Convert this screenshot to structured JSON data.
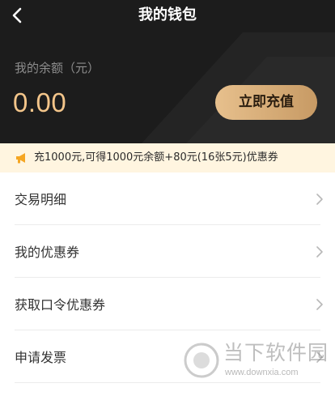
{
  "header": {
    "title": "我的钱包",
    "back_icon": "chevron-left-icon",
    "background": "#1c1c1c"
  },
  "balance": {
    "label": "我的余额（元）",
    "value": "0.00",
    "value_color": "#f3c58a"
  },
  "recharge": {
    "label": "立即充值",
    "color": "#d9ae78"
  },
  "promo": {
    "icon": "megaphone-icon",
    "text": "充1000元,可得1000元余额+80元(16张5元)优惠券",
    "background": "#fff5e0",
    "icon_color": "#f5a623"
  },
  "menu": {
    "items": [
      {
        "label": "交易明细"
      },
      {
        "label": "我的优惠券"
      },
      {
        "label": "获取口令优惠券"
      },
      {
        "label": "申请发票"
      }
    ]
  },
  "watermark": {
    "title": "当下软件园",
    "url": "www.downxia.com"
  }
}
